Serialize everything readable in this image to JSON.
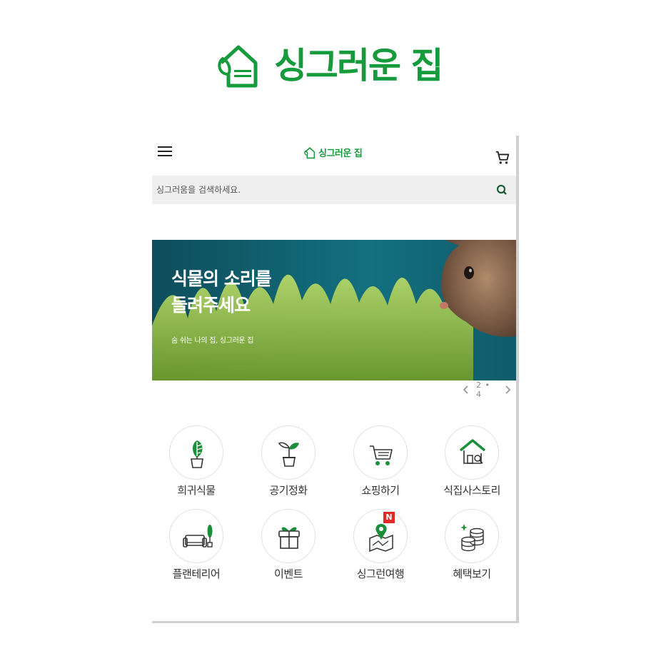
{
  "brand": {
    "name": "싱그러운 집"
  },
  "app": {
    "header": {
      "brand_name": "싱그러운 집"
    },
    "search": {
      "placeholder": "싱그러움을 검색하세요."
    },
    "banner": {
      "title_line1": "식물의 소리를",
      "title_line2": "들려주세요",
      "subtitle": "숨 쉬는 나의 집, 싱그러운 집",
      "pager": "2 • 4"
    },
    "menu": [
      {
        "label": "희귀식물",
        "icon": "monstera-plant-icon"
      },
      {
        "label": "공기정화",
        "icon": "sprout-pot-icon"
      },
      {
        "label": "쇼핑하기",
        "icon": "shopping-cart-icon"
      },
      {
        "label": "식집사스토리",
        "icon": "house-search-icon"
      },
      {
        "label": "플랜테리어",
        "icon": "sofa-plant-icon"
      },
      {
        "label": "이벤트",
        "icon": "gift-icon"
      },
      {
        "label": "싱그런여행",
        "icon": "map-pin-icon",
        "badge": "N"
      },
      {
        "label": "혜택보기",
        "icon": "coins-icon"
      }
    ]
  },
  "colors": {
    "brand_green": "#159a3c",
    "banner_teal": "#0f5b6a",
    "badge_red": "#e02a2a"
  }
}
